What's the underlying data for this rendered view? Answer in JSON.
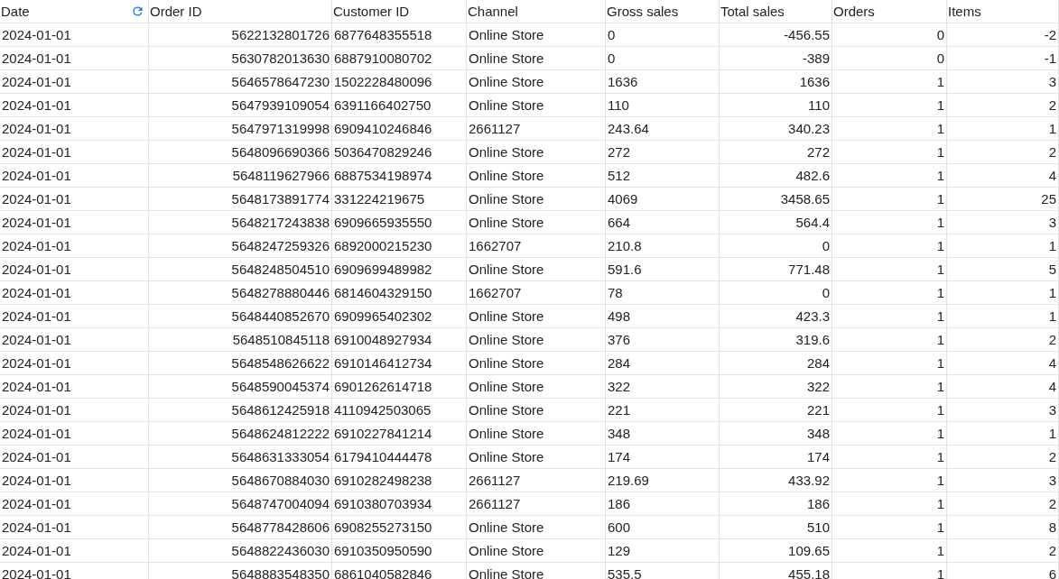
{
  "table": {
    "columns": [
      {
        "label": "Date",
        "kind": "text",
        "refresh": true
      },
      {
        "label": "Order ID",
        "kind": "number",
        "refresh": false
      },
      {
        "label": "Customer ID",
        "kind": "text",
        "refresh": false
      },
      {
        "label": "Channel",
        "kind": "text",
        "refresh": false
      },
      {
        "label": "Gross sales",
        "kind": "text",
        "refresh": false
      },
      {
        "label": "Total sales",
        "kind": "number",
        "refresh": false
      },
      {
        "label": "Orders",
        "kind": "number",
        "refresh": false
      },
      {
        "label": "Items",
        "kind": "number",
        "refresh": false
      }
    ],
    "rows": [
      [
        "2024-01-01",
        "5622132801726",
        "6877648355518",
        "Online Store",
        "0",
        "-456.55",
        "0",
        "-2"
      ],
      [
        "2024-01-01",
        "5630782013630",
        "6887910080702",
        "Online Store",
        "0",
        "-389",
        "0",
        "-1"
      ],
      [
        "2024-01-01",
        "5646578647230",
        "1502228480096",
        "Online Store",
        "1636",
        "1636",
        "1",
        "3"
      ],
      [
        "2024-01-01",
        "5647939109054",
        "6391166402750",
        "Online Store",
        "110",
        "110",
        "1",
        "2"
      ],
      [
        "2024-01-01",
        "5647971319998",
        "6909410246846",
        "2661127",
        "243.64",
        "340.23",
        "1",
        "1"
      ],
      [
        "2024-01-01",
        "5648096690366",
        "5036470829246",
        "Online Store",
        "272",
        "272",
        "1",
        "2"
      ],
      [
        "2024-01-01",
        "5648119627966",
        "6887534198974",
        "Online Store",
        "512",
        "482.6",
        "1",
        "4"
      ],
      [
        "2024-01-01",
        "5648173891774",
        "331224219675",
        "Online Store",
        "4069",
        "3458.65",
        "1",
        "25"
      ],
      [
        "2024-01-01",
        "5648217243838",
        "6909665935550",
        "Online Store",
        "664",
        "564.4",
        "1",
        "3"
      ],
      [
        "2024-01-01",
        "5648247259326",
        "6892000215230",
        "1662707",
        "210.8",
        "0",
        "1",
        "1"
      ],
      [
        "2024-01-01",
        "5648248504510",
        "6909699489982",
        "Online Store",
        "591.6",
        "771.48",
        "1",
        "5"
      ],
      [
        "2024-01-01",
        "5648278880446",
        "6814604329150",
        "1662707",
        "78",
        "0",
        "1",
        "1"
      ],
      [
        "2024-01-01",
        "5648440852670",
        "6909965402302",
        "Online Store",
        "498",
        "423.3",
        "1",
        "1"
      ],
      [
        "2024-01-01",
        "5648510845118",
        "6910048927934",
        "Online Store",
        "376",
        "319.6",
        "1",
        "2"
      ],
      [
        "2024-01-01",
        "5648548626622",
        "6910146412734",
        "Online Store",
        "284",
        "284",
        "1",
        "4"
      ],
      [
        "2024-01-01",
        "5648590045374",
        "6901262614718",
        "Online Store",
        "322",
        "322",
        "1",
        "4"
      ],
      [
        "2024-01-01",
        "5648612425918",
        "4110942503065",
        "Online Store",
        "221",
        "221",
        "1",
        "3"
      ],
      [
        "2024-01-01",
        "5648624812222",
        "6910227841214",
        "Online Store",
        "348",
        "348",
        "1",
        "1"
      ],
      [
        "2024-01-01",
        "5648631333054",
        "6179410444478",
        "Online Store",
        "174",
        "174",
        "1",
        "2"
      ],
      [
        "2024-01-01",
        "5648670884030",
        "6910282498238",
        "2661127",
        "219.69",
        "433.92",
        "1",
        "3"
      ],
      [
        "2024-01-01",
        "5648747004094",
        "6910380703934",
        "2661127",
        "186",
        "186",
        "1",
        "2"
      ],
      [
        "2024-01-01",
        "5648778428606",
        "6908255273150",
        "Online Store",
        "600",
        "510",
        "1",
        "8"
      ],
      [
        "2024-01-01",
        "5648822436030",
        "6910350950590",
        "Online Store",
        "129",
        "109.65",
        "1",
        "2"
      ],
      [
        "2024-01-01",
        "5648883548350",
        "6861040582846",
        "Online Store",
        "535.5",
        "455.18",
        "1",
        "6"
      ]
    ]
  }
}
